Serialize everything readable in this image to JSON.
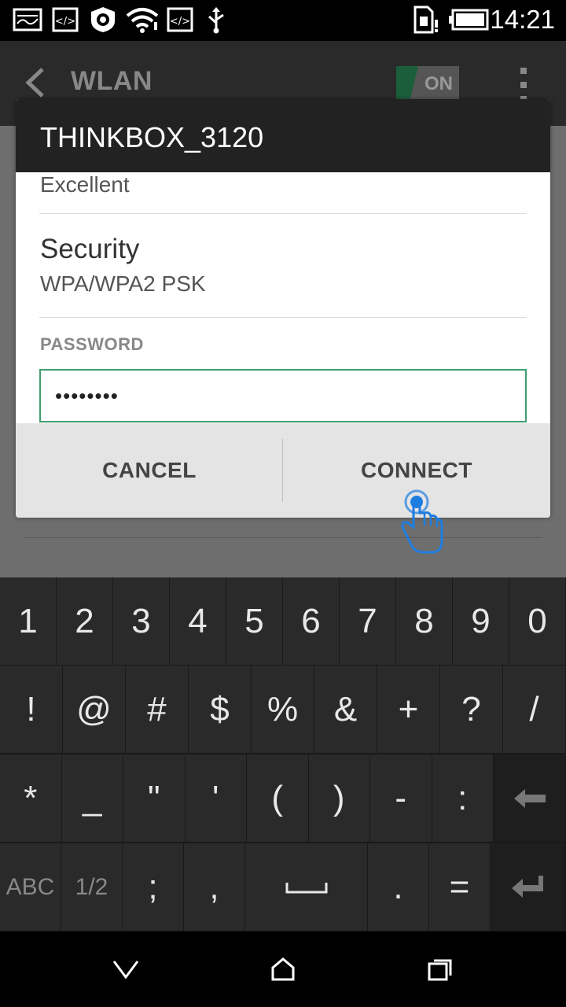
{
  "status_bar": {
    "time": "14:21",
    "icons": [
      "image-icon",
      "code-icon",
      "settings-shield-icon",
      "wifi-icon",
      "code-icon",
      "usb-icon",
      "sim-alert-icon",
      "battery-icon"
    ]
  },
  "app_bar": {
    "title": "WLAN",
    "toggle_label": "ON"
  },
  "dialog": {
    "title": "THINKBOX_3120",
    "signal_strength_value": "Excellent",
    "security_label": "Security",
    "security_value": "WPA/WPA2 PSK",
    "password_label": "PASSWORD",
    "password_value": "••••••••",
    "cancel_label": "CANCEL",
    "connect_label": "CONNECT"
  },
  "keyboard": {
    "row1": [
      "1",
      "2",
      "3",
      "4",
      "5",
      "6",
      "7",
      "8",
      "9",
      "0"
    ],
    "row2": [
      "!",
      "@",
      "#",
      "$",
      "%",
      "&",
      "+",
      "?",
      "/"
    ],
    "row3": [
      "*",
      "_",
      "\"",
      "'",
      "(",
      ")",
      "-",
      ":"
    ],
    "row4_left": [
      "ABC",
      "1/2"
    ],
    "row4_mid": [
      ";",
      ",",
      "␣",
      ".",
      "="
    ]
  },
  "colors": {
    "accent_green": "#3f9e6e",
    "tap_blue": "#1e7de0"
  }
}
